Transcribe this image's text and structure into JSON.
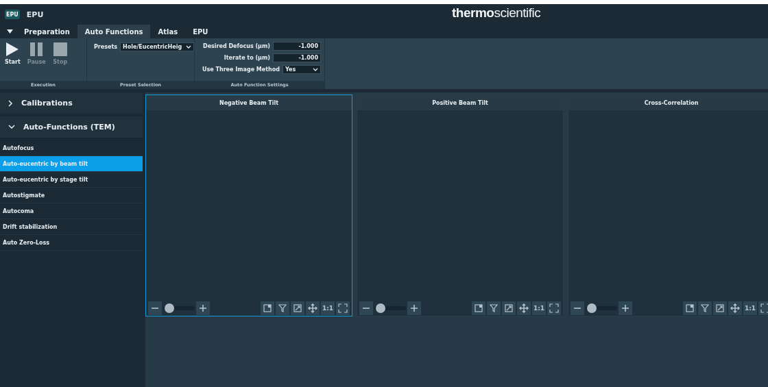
{
  "window": {
    "title": "EPU",
    "app_badge": "EPU",
    "logo": "**thermo**scientific"
  },
  "tabs": [
    {
      "label": "Preparation",
      "selected": false
    },
    {
      "label": "Auto Functions",
      "selected": true
    },
    {
      "label": "Atlas",
      "selected": false
    },
    {
      "label": "EPU",
      "selected": false
    }
  ],
  "ribbon": {
    "execution": {
      "label": "Execution",
      "buttons": [
        {
          "kind": "play",
          "label": "Start",
          "disabled": false
        },
        {
          "kind": "pause",
          "label": "Pause",
          "disabled": true
        },
        {
          "kind": "stop",
          "label": "Stop",
          "disabled": true
        }
      ]
    },
    "preset_selection": {
      "label": "Preset Selection",
      "presets_label": "Presets",
      "presets_value": "Hole/EucentricHeig"
    },
    "settings": {
      "label": "Auto Function Settings",
      "fields": [
        {
          "kind": "number",
          "label": "Desired Defocus (µm)",
          "value": "-1.000"
        },
        {
          "kind": "number",
          "label": "Iterate to (µm)",
          "value": "-1.000"
        },
        {
          "kind": "select",
          "label": "Use Three Image Method",
          "value": "Yes"
        }
      ]
    }
  },
  "sidebar": {
    "sections": [
      {
        "label": "Calibrations",
        "expanded": false
      },
      {
        "label": "Auto-Functions (TEM)",
        "expanded": true,
        "children": [
          {
            "label": "Autofocus",
            "selected": false
          },
          {
            "label": "Auto-eucentric by beam tilt",
            "selected": true
          },
          {
            "label": "Auto-eucentric by stage tilt",
            "selected": false
          },
          {
            "label": "Autostigmate",
            "selected": false
          },
          {
            "label": "Autocoma",
            "selected": false
          },
          {
            "label": "Drift stabilization",
            "selected": false
          },
          {
            "label": "Auto Zero-Loss",
            "selected": false
          }
        ]
      }
    ]
  },
  "panels": [
    {
      "title": "Negative Beam Tilt",
      "selected": true,
      "zoom": {
        "level": 0.2
      },
      "actual_size": "1:1"
    },
    {
      "title": "Positive Beam Tilt",
      "selected": false,
      "zoom": {
        "level": 0.2
      },
      "actual_size": "1:1"
    },
    {
      "title": "Cross-Correlation",
      "selected": false,
      "zoom": {
        "level": 0.2
      },
      "actual_size": "1:1"
    }
  ]
}
